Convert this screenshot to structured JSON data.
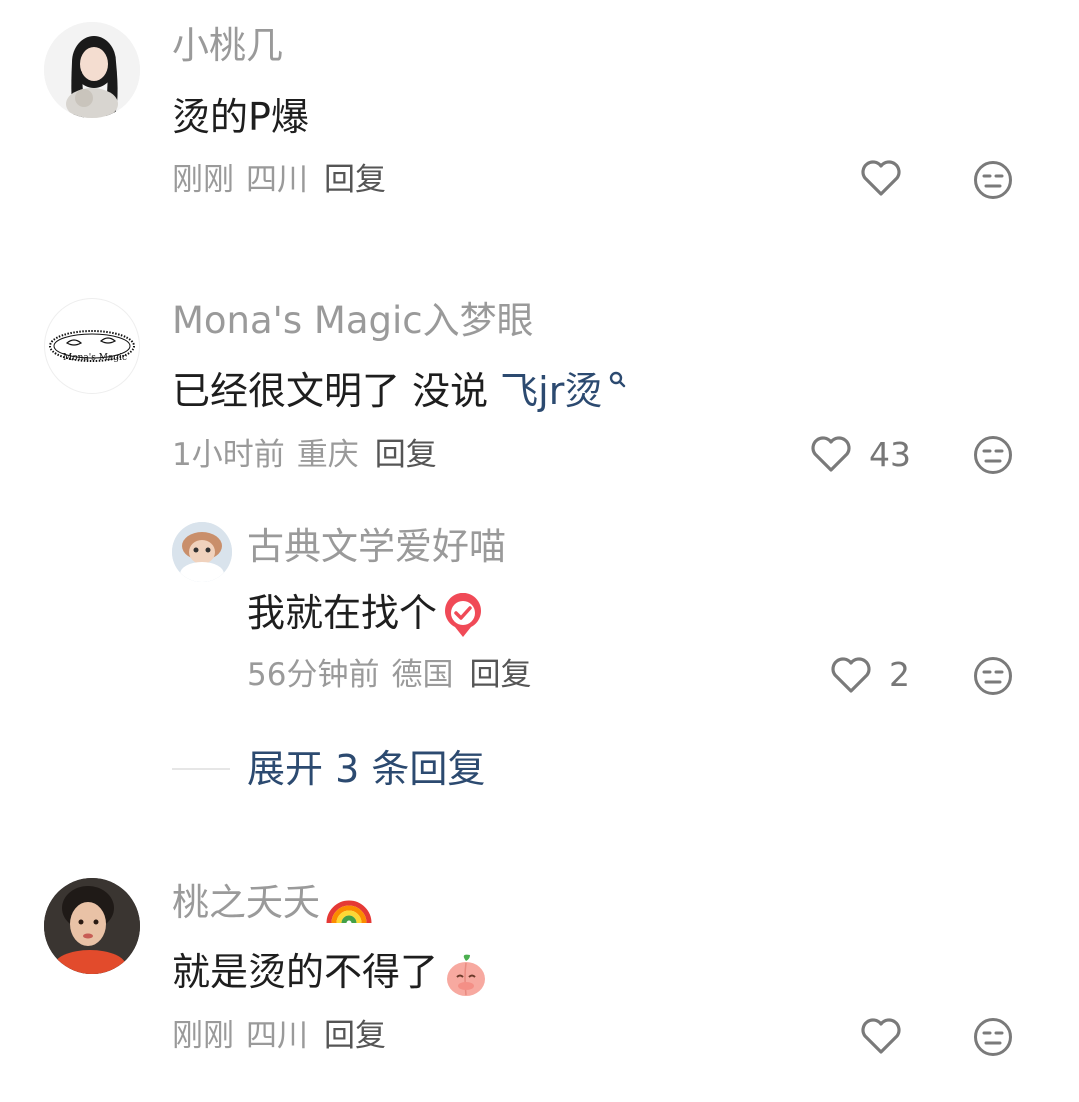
{
  "comments": [
    {
      "username": "小桃几",
      "text": "烫的P爆",
      "time": "刚刚",
      "location": "四川",
      "reply_label": "回复",
      "likes": ""
    },
    {
      "username": "Mona's Magic入梦眼",
      "avatar_text": "Mona's Magic",
      "text": "已经很文明了 没说 ",
      "link_text": "飞jr烫",
      "time": "1小时前",
      "location": "重庆",
      "reply_label": "回复",
      "likes": "43",
      "replies": [
        {
          "username": "古典文学爱好喵",
          "text": "我就在找个",
          "time": "56分钟前",
          "location": "德国",
          "reply_label": "回复",
          "likes": "2"
        }
      ],
      "expand_label": "展开 3 条回复"
    },
    {
      "username": "桃之夭夭",
      "text": "就是烫的不得了",
      "time": "刚刚",
      "location": "四川",
      "reply_label": "回复",
      "likes": ""
    }
  ],
  "colors": {
    "username": "#9a9a9a",
    "link": "#2c4a70",
    "icon": "#7a7a7a"
  }
}
